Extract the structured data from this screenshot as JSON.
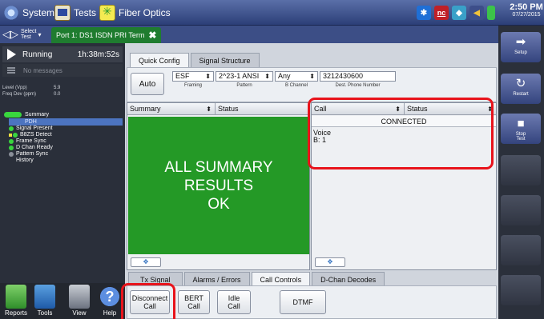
{
  "topbar": {
    "system_label": "System",
    "tests_label": "Tests",
    "fiber_label": "Fiber Optics",
    "clock_time": "2:50 PM",
    "clock_date": "07/27/2015",
    "status_nc": "nc"
  },
  "testbar": {
    "select_label_1": "Select",
    "select_label_2": "Test",
    "port_tab": "Port 1: DS1 ISDN PRI Term"
  },
  "left": {
    "run_state": "Running",
    "run_time": "1h:38m:52s",
    "messages": "No messages",
    "level_label": "Level (Vpp)",
    "level_value": "5.9",
    "freq_label": "Freq Dev (ppm)",
    "freq_value": "0.0",
    "summary": "Summary",
    "pdh": "PDH",
    "items": [
      "Signal Present",
      "B8ZS Detect",
      "Frame Sync",
      "D Chan Ready",
      "Pattern Sync",
      "History"
    ]
  },
  "tools": {
    "reports": "Reports",
    "tools": "Tools",
    "view": "View",
    "help": "Help"
  },
  "config": {
    "tab_quick": "Quick Config",
    "tab_structure": "Signal Structure",
    "auto": "Auto",
    "framing_value": "ESF",
    "framing_label": "Framing",
    "pattern_value": "2^23-1 ANSI",
    "pattern_label": "Pattern",
    "bchannel_value": "Any",
    "bchannel_label": "B Channel",
    "phone_value": "3212430600",
    "phone_label": "Dest. Phone Number"
  },
  "summary_pane": {
    "col1": "Summary",
    "col2": "Status",
    "line1": "ALL SUMMARY",
    "line2": "RESULTS",
    "line3": "OK"
  },
  "call_pane": {
    "col1": "Call",
    "col2": "Status",
    "status": "CONNECTED",
    "line1": "Voice",
    "line2": "B: 1"
  },
  "bottom_tabs": [
    "Tx Signal",
    "Alarms / Errors",
    "Call Controls",
    "D-Chan Decodes"
  ],
  "call_buttons": {
    "disconnect_1": "Disconnect",
    "disconnect_2": "Call",
    "bert_1": "BERT",
    "bert_2": "Call",
    "idle_1": "Idle",
    "idle_2": "Call",
    "dtmf": "DTMF"
  },
  "right": {
    "setup": "Setup",
    "restart": "Restart",
    "stop_1": "Stop",
    "stop_2": "Test"
  },
  "colors": {
    "summary_ok": "#249926",
    "highlight": "#e8131b",
    "accent": "#34447e"
  }
}
